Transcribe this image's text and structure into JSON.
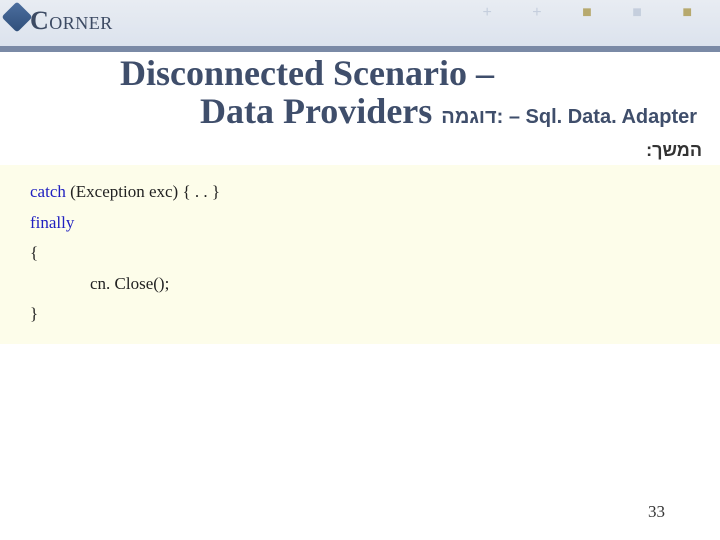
{
  "logo": {
    "text": "ORNER"
  },
  "title": {
    "line1": "Disconnected Scenario –",
    "line2_prefix": "Data Providers ",
    "heb": "דוגמה:",
    "dash": " – ",
    "eng": "Sql. Data. Adapter"
  },
  "continuation": "המשך:",
  "code": {
    "l1_kw": "catch",
    "l1_rest": " (Exception exc) { . . }",
    "l2_kw": "finally",
    "l3": "{",
    "l4": "cn. Close();",
    "l5": "}"
  },
  "page": "33"
}
